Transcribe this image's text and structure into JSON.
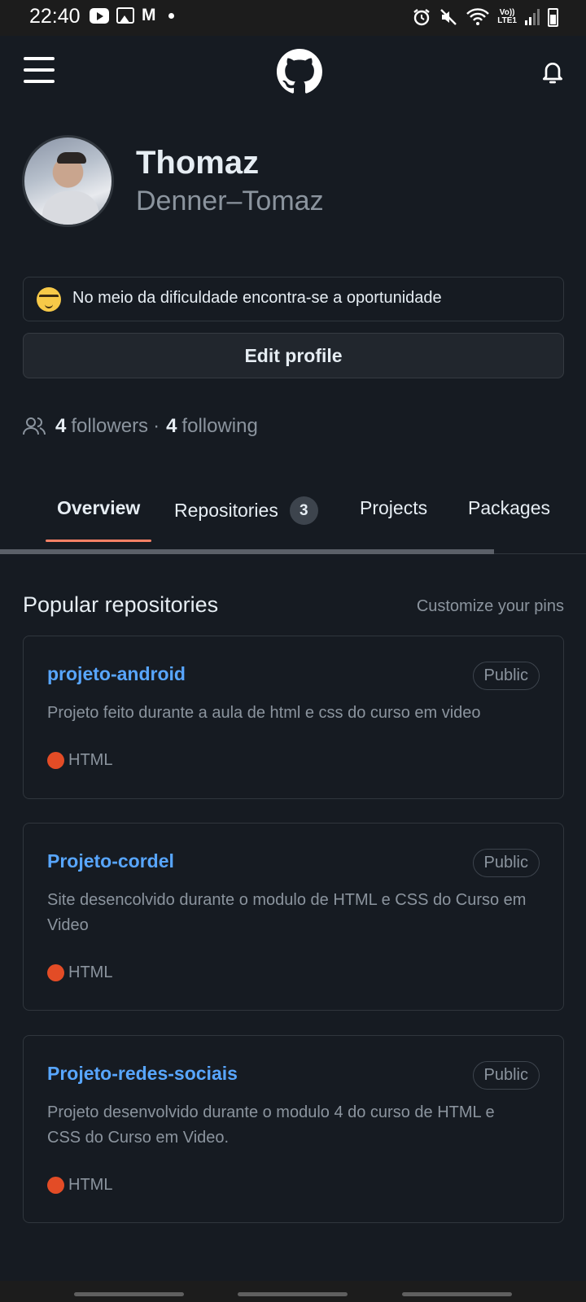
{
  "status_bar": {
    "time": "22:40",
    "gmail_glyph": "M",
    "network_label_top": "Vo))",
    "network_label_bottom": "LTE1",
    "icons": [
      "youtube-icon",
      "gallery-icon",
      "gmail-icon",
      "notification-dot-icon",
      "alarm-icon",
      "mute-icon",
      "wifi-icon",
      "signal-icon",
      "battery-icon"
    ]
  },
  "header": {
    "icons": [
      "menu-icon",
      "github-logo-icon",
      "bell-icon"
    ]
  },
  "profile": {
    "name": "Thomaz",
    "login": "Denner–Tomaz",
    "status_emoji": "nerd-face-emoji",
    "status_text": "No meio da dificuldade encontra-se a oportunidade",
    "edit_button": "Edit profile",
    "followers_count": "4",
    "followers_label": "followers",
    "separator": "·",
    "following_count": "4",
    "following_label": "following"
  },
  "tabs": [
    {
      "label": "Overview",
      "active": true
    },
    {
      "label": "Repositories",
      "count": "3"
    },
    {
      "label": "Projects"
    },
    {
      "label": "Packages"
    }
  ],
  "popular": {
    "title": "Popular repositories",
    "customize": "Customize your pins",
    "repos": [
      {
        "name": "projeto-android",
        "visibility": "Public",
        "description": "Projeto feito durante a aula de html e css do curso em video",
        "language": "HTML",
        "language_color": "#e34c26"
      },
      {
        "name": "Projeto-cordel",
        "visibility": "Public",
        "description": "Site desencolvido durante o modulo de HTML e CSS do Curso em Video",
        "language": "HTML",
        "language_color": "#e34c26"
      },
      {
        "name": "Projeto-redes-sociais",
        "visibility": "Public",
        "description": "Projeto desenvolvido durante o modulo 4 do curso de HTML e CSS do Curso em Video.",
        "language": "HTML",
        "language_color": "#e34c26"
      }
    ]
  },
  "colors": {
    "background": "#161b22",
    "link": "#58a6ff",
    "active_tab_underline": "#f78166",
    "muted_text": "#8b949e"
  }
}
